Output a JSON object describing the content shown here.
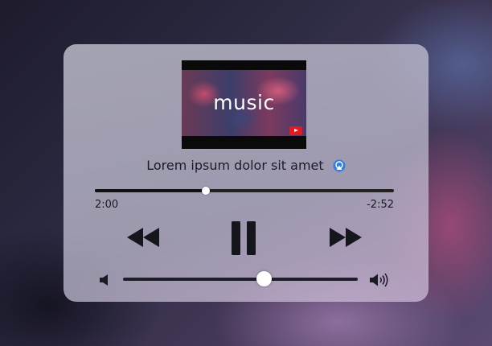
{
  "video": {
    "title": "music",
    "badge_icon": "youtube-play-icon",
    "badge_color": "#e5191f"
  },
  "track": {
    "title": "Lorem ipsum dolor sit amet",
    "airplay_icon": "airplay-icon",
    "airplay_color": "#2f7fe0"
  },
  "playback": {
    "elapsed": "2:00",
    "remaining": "-2:52",
    "progress": 0.37
  },
  "controls": {
    "rewind_icon": "rewind-icon",
    "pause_icon": "pause-icon",
    "forward_icon": "fast-forward-icon"
  },
  "volume": {
    "low_icon": "volume-low-icon",
    "high_icon": "volume-high-icon",
    "level": 0.6
  }
}
